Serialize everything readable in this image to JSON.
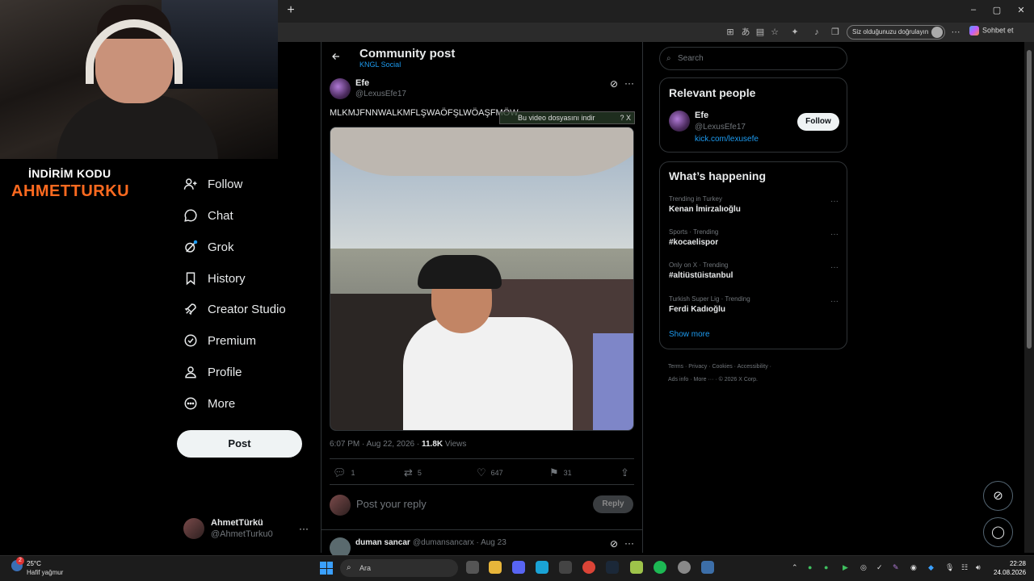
{
  "browser": {
    "new_tab": "+",
    "window_controls": [
      "–",
      "▢",
      "✕"
    ],
    "verify_label": "Siz olduğunuzu doğrulayın",
    "chat_label": "Sohbet et",
    "menu_dots": "⋯"
  },
  "stream": {
    "promo_line1": "İNDİRİM KODU",
    "promo_line2": "AHMETTURKU",
    "accent_color": "#ff6a1f"
  },
  "nav": {
    "items": [
      {
        "label": "Follow",
        "icon": "follow-icon"
      },
      {
        "label": "Chat",
        "icon": "chat-icon"
      },
      {
        "label": "Grok",
        "icon": "grok-icon"
      },
      {
        "label": "History",
        "icon": "bookmark-icon"
      },
      {
        "label": "Creator Studio",
        "icon": "rocket-icon"
      },
      {
        "label": "Premium",
        "icon": "verified-icon"
      },
      {
        "label": "Profile",
        "icon": "profile-icon"
      },
      {
        "label": "More",
        "icon": "more-circle-icon"
      }
    ],
    "post_label": "Post",
    "account": {
      "name": "AhmetTürkü",
      "handle": "@AhmetTurku0",
      "more": "···"
    }
  },
  "main": {
    "header": {
      "title": "Community post",
      "subtitle": "KNGL Social"
    },
    "tweet": {
      "name": "Efe",
      "handle": "@LexusEfe17",
      "text": "MLKMJFNNWALKMFLŞWAÖFŞLWÖAŞFMÖW",
      "video_overlay": "Bu video dosyasını indir",
      "video_overlay_close": "? X",
      "time": "6:07 PM · Aug 22, 2026 · ",
      "views_count": "11.8K",
      "views_label": " Views",
      "actions": {
        "replies": "1",
        "reposts": "5",
        "likes": "647",
        "bookmarks": "31"
      }
    },
    "reply": {
      "placeholder": "Post your reply",
      "button": "Reply"
    },
    "next_reply": {
      "name": "duman sancar",
      "meta": "@dumansancarx · Aug 23"
    }
  },
  "sidebar": {
    "search_placeholder": "Search",
    "relevant": {
      "title": "Relevant people",
      "name": "Efe",
      "handle": "@LexusEfe17",
      "link": "kick.com/lexusefe",
      "follow_label": "Follow"
    },
    "happening": {
      "title": "What’s happening",
      "trends": [
        {
          "context": "Trending in Turkey",
          "topic": "Kenan İmirzalıoğlu"
        },
        {
          "context": "Sports · Trending",
          "topic": "#kocaelispor"
        },
        {
          "context": "Only on X · Trending",
          "topic": "#altiüstüistanbul"
        },
        {
          "context": "Turkish Super Lig · Trending",
          "topic": "Ferdi Kadıoğlu"
        }
      ],
      "show_more": "Show more"
    },
    "footer": {
      "line1": "Terms  ·  Privacy  ·  Cookies  ·  Accessibility  ·",
      "line2": "Ads info  ·  More ···  ·  © 2026 X Corp."
    }
  },
  "taskbar": {
    "weather_temp": "25°C",
    "weather_cond": "Hafif yağmur",
    "weather_badge": "2",
    "search_label": "Ara",
    "time": "22:28",
    "date": "24.08.2026"
  }
}
